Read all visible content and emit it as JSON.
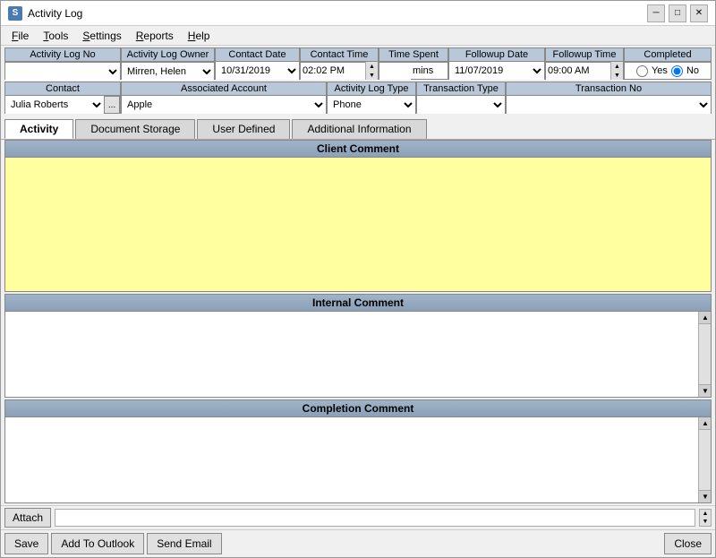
{
  "window": {
    "title": "Activity Log",
    "icon": "S"
  },
  "titlebar": {
    "minimize": "─",
    "maximize": "□",
    "close": "✕"
  },
  "menu": {
    "items": [
      "File",
      "Tools",
      "Settings",
      "Reports",
      "Help"
    ]
  },
  "row1": {
    "labels": [
      "Activity Log No",
      "Activity Log Owner",
      "Contact Date",
      "Contact Time",
      "Time Spent",
      "Followup Date",
      "Followup Time",
      "Completed"
    ],
    "owner_value": "Mirren, Helen",
    "contact_date": "10/31/2019",
    "contact_time": "02:02 PM",
    "time_spent": "",
    "mins_label": "mins",
    "followup_date": "11/07/2019",
    "followup_time": "09:00 AM",
    "completed_yes": "Yes",
    "completed_no": "No"
  },
  "row2": {
    "labels": [
      "Contact",
      "Associated Account",
      "Activity Log Type",
      "Transaction Type",
      "Transaction No"
    ],
    "contact_value": "Julia  Roberts",
    "account_value": "Apple",
    "log_type_value": "Phone",
    "transaction_type": "",
    "transaction_no": ""
  },
  "tabs": {
    "items": [
      "Activity",
      "Document Storage",
      "User Defined",
      "Additional Information"
    ],
    "active": 0
  },
  "sections": {
    "client_comment": {
      "header": "Client Comment",
      "value": ""
    },
    "internal_comment": {
      "header": "Internal Comment",
      "value": ""
    },
    "completion_comment": {
      "header": "Completion Comment",
      "value": ""
    }
  },
  "buttons": {
    "attach": "Attach",
    "save": "Save",
    "add_to_outlook": "Add To Outlook",
    "send_email": "Send Email",
    "close": "Close"
  }
}
